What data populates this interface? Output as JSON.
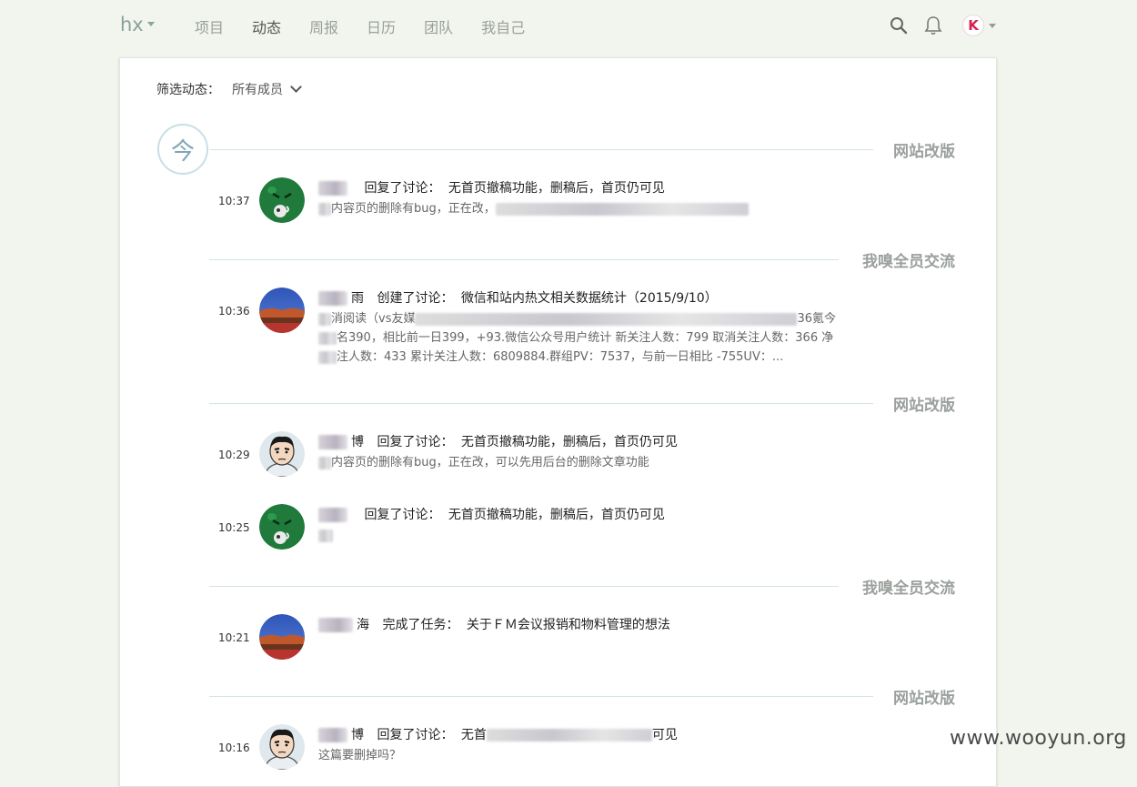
{
  "nav": {
    "brand": "hx",
    "items": [
      {
        "label": "项目",
        "active": false
      },
      {
        "label": "动态",
        "active": true
      },
      {
        "label": "周报",
        "active": false
      },
      {
        "label": "日历",
        "active": false
      },
      {
        "label": "团队",
        "active": false
      },
      {
        "label": "我自己",
        "active": false
      }
    ],
    "avatar_letter": "K"
  },
  "filter": {
    "label": "筛选动态：",
    "value": "所有成员"
  },
  "today_badge": "今",
  "groups": [
    {
      "project": "网站改版",
      "entries": [
        {
          "time": "10:37",
          "avatar": "green-monster",
          "user_tail": "",
          "action": "回复了讨论：",
          "target": "无首页撤稿功能，删稿后，首页仍可见",
          "snippet_lines": [
            "内容页的删除有bug，正在改，"
          ]
        }
      ]
    },
    {
      "project": "我嗅全员交流",
      "entries": [
        {
          "time": "10:36",
          "avatar": "blue-landscape",
          "user_tail": "雨",
          "action": "创建了讨论：",
          "target": "微信和站内热文相关数据统计（2015/9/10）",
          "snippet_lines": [
            "消阅读（vs友媒",
            "36氪今",
            "名390，相比前一日399，+93.微信公众号用户统计 新关注人数：799 取消关注人数：366 净",
            "注人数：433 累计关注人数：6809884.群组PV：7537，与前一日相比 -755UV：..."
          ]
        }
      ]
    },
    {
      "project": "网站改版",
      "entries": [
        {
          "time": "10:29",
          "avatar": "cartoon-man",
          "user_tail": "博",
          "action": "回复了讨论：",
          "target": "无首页撤稿功能，删稿后，首页仍可见",
          "snippet_lines": [
            "内容页的删除有bug，正在改，可以先用后台的删除文章功能"
          ]
        },
        {
          "time": "10:25",
          "avatar": "green-monster",
          "user_tail": "",
          "action": "回复了讨论：",
          "target": "无首页撤稿功能，删稿后，首页仍可见",
          "snippet_lines": [
            ""
          ]
        }
      ]
    },
    {
      "project": "我嗅全员交流",
      "entries": [
        {
          "time": "10:21",
          "avatar": "blue-landscape",
          "user_tail": "海",
          "action": "完成了任务：",
          "target": "关于ＦＭ会议报销和物料管理的想法",
          "snippet_lines": []
        }
      ]
    },
    {
      "project": "网站改版",
      "entries": [
        {
          "time": "10:16",
          "avatar": "cartoon-man",
          "user_tail": "博",
          "action": "回复了讨论：",
          "target": "无首",
          "target_tail": "可见",
          "snippet_lines": [
            "这篇要删掉吗？"
          ]
        }
      ]
    }
  ],
  "watermark": "www.wooyun.org"
}
